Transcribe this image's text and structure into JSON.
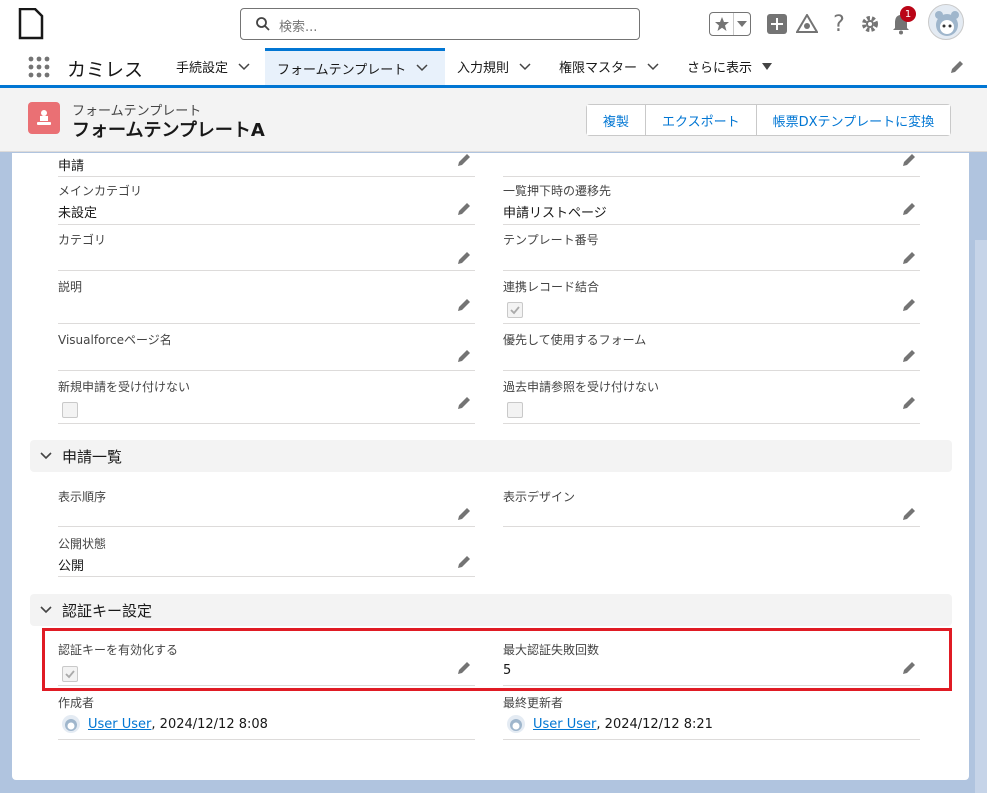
{
  "header": {
    "search_placeholder": "検索...",
    "notification_count": "1"
  },
  "nav": {
    "app_name": "カミレス",
    "tabs": [
      {
        "label": "手続設定"
      },
      {
        "label": "フォームテンプレート"
      },
      {
        "label": "入力規則"
      },
      {
        "label": "権限マスター"
      },
      {
        "label": "さらに表示"
      }
    ]
  },
  "page": {
    "object_type": "フォームテンプレート",
    "record_title": "フォームテンプレートA",
    "buttons": [
      {
        "label": "複製"
      },
      {
        "label": "エクスポート"
      },
      {
        "label": "帳票DXテンプレートに変換"
      }
    ]
  },
  "details": {
    "top_value": "申請",
    "main_category": {
      "label": "メインカテゴリ",
      "value": "未設定"
    },
    "list_destination": {
      "label": "一覧押下時の遷移先",
      "value": "申請リストページ"
    },
    "category": {
      "label": "カテゴリ",
      "value": ""
    },
    "template_number": {
      "label": "テンプレート番号",
      "value": ""
    },
    "description": {
      "label": "説明",
      "value": ""
    },
    "linked_record_join": {
      "label": "連携レコード結合",
      "checked": true
    },
    "visualforce_page": {
      "label": "Visualforceページ名",
      "value": ""
    },
    "preferred_form": {
      "label": "優先して使用するフォーム",
      "value": ""
    },
    "reject_new": {
      "label": "新規申請を受け付けない",
      "checked": false
    },
    "reject_past": {
      "label": "過去申請参照を受け付けない",
      "checked": false
    }
  },
  "section_list": {
    "title": "申請一覧",
    "display_order": {
      "label": "表示順序",
      "value": ""
    },
    "display_design": {
      "label": "表示デザイン",
      "value": ""
    },
    "publish_status": {
      "label": "公開状態",
      "value": "公開"
    }
  },
  "section_auth": {
    "title": "認証キー設定",
    "enable_auth": {
      "label": "認証キーを有効化する",
      "checked": true
    },
    "max_failures": {
      "label": "最大認証失敗回数",
      "value": "5"
    }
  },
  "system": {
    "created_by": {
      "label": "作成者",
      "user": "User User",
      "date": ", 2024/12/12 8:08"
    },
    "modified_by": {
      "label": "最終更新者",
      "user": "User User",
      "date": ", 2024/12/12 8:21"
    }
  },
  "colors": {
    "brand": "#0176d3",
    "highlight": "#e01b24",
    "object_icon": "#ea7074"
  }
}
